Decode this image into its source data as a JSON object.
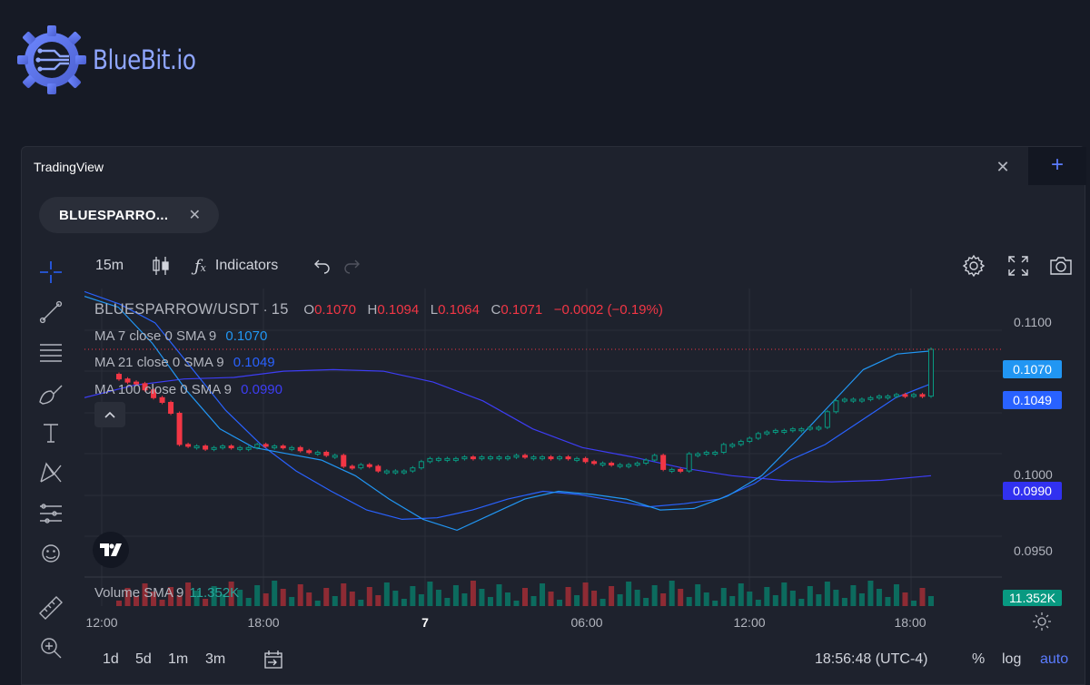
{
  "brand": {
    "name": "BlueBit.io"
  },
  "panel": {
    "title": "TradingView",
    "close": "✕",
    "add": "+"
  },
  "tab": {
    "label": "BLUESPARRO...",
    "close": "✕"
  },
  "left_toolbar": [
    "crosshair-icon",
    "trend-line-icon",
    "fib-retracement-icon",
    "brush-icon",
    "text-icon",
    "pattern-icon",
    "prediction-icon",
    "emoji-icon",
    "ruler-icon",
    "zoom-in-icon"
  ],
  "top_toolbar": {
    "interval": "15m",
    "chart_type_icon": "candles-icon",
    "indicators": "Indicators",
    "undo_icon": "undo-icon",
    "redo_icon": "redo-icon",
    "settings_icon": "gear-icon",
    "fullscreen_icon": "fullscreen-icon",
    "snapshot_icon": "camera-icon"
  },
  "legend": {
    "symbol": "BLUESPARROW/USDT",
    "interval": "15",
    "o_key": "O",
    "o": "0.1070",
    "h_key": "H",
    "h": "0.1094",
    "l_key": "L",
    "l": "0.1064",
    "c_key": "C",
    "c": "0.1071",
    "change": "−0.0002 (−0.19%)",
    "ma7": {
      "label": "MA 7 close 0 SMA 9",
      "value": "0.1070",
      "color": "#2196f3"
    },
    "ma21": {
      "label": "MA 21 close 0 SMA 9",
      "value": "0.1049",
      "color": "#2962ff"
    },
    "ma100": {
      "label": "MA 100 close 0 SMA 9",
      "value": "0.0990",
      "color": "#3d3df5"
    },
    "volume": {
      "label": "Volume SMA 9",
      "value": "11.352K"
    }
  },
  "price_axis": {
    "ticks": [
      "0.1100",
      "0.1000",
      "0.0950"
    ],
    "labels": [
      {
        "text": "0.1070",
        "color": "#2196f3"
      },
      {
        "text": "0.1049",
        "color": "#2962ff"
      },
      {
        "text": "0.0990",
        "color": "#3131f0"
      },
      {
        "text": "11.352K",
        "color": "#089981"
      }
    ]
  },
  "time_axis": [
    "12:00",
    "18:00",
    "7",
    "06:00",
    "12:00",
    "18:00"
  ],
  "bottom_bar": {
    "ranges": [
      "1d",
      "5d",
      "1m",
      "3m"
    ],
    "goto_icon": "goto-date-icon",
    "clock": "18:56:48 (UTC-4)",
    "percent": "%",
    "log": "log",
    "auto": "auto",
    "auto_color": "#5b7cff",
    "settings_icon": "sun-gear-icon"
  },
  "chart_data": {
    "type": "candlestick",
    "symbol": "BLUESPARROW/USDT",
    "interval": "15",
    "ylim": [
      0.0925,
      0.111
    ],
    "gridlines": true,
    "x_ticks": [
      "12:00",
      "18:00",
      "7",
      "06:00",
      "12:00",
      "18:00"
    ],
    "candles_close": [
      0.1052,
      0.105,
      0.1049,
      0.1045,
      0.104,
      0.1037,
      0.103,
      0.101,
      0.1009,
      0.1009,
      0.1007,
      0.1008,
      0.1009,
      0.1008,
      0.1008,
      0.1008,
      0.101,
      0.1009,
      0.1009,
      0.1008,
      0.1008,
      0.1006,
      0.1005,
      0.1005,
      0.1003,
      0.1003,
      0.0996,
      0.0995,
      0.0997,
      0.0996,
      0.0993,
      0.0993,
      0.0993,
      0.0993,
      0.0995,
      0.0999,
      0.1001,
      0.1001,
      0.1001,
      0.1001,
      0.1002,
      0.1001,
      0.1002,
      0.1002,
      0.1002,
      0.1002,
      0.1003,
      0.1002,
      0.1002,
      0.1002,
      0.1001,
      0.1002,
      0.1001,
      0.1001,
      0.0999,
      0.0998,
      0.0998,
      0.0997,
      0.0997,
      0.0997,
      0.0998,
      0.1,
      0.1003,
      0.0994,
      0.0994,
      0.0993,
      0.1004,
      0.1004,
      0.1005,
      0.1005,
      0.101,
      0.101,
      0.1012,
      0.1014,
      0.1017,
      0.1018,
      0.1019,
      0.1019,
      0.102,
      0.102,
      0.1021,
      0.1021,
      0.1031,
      0.1038,
      0.1039,
      0.1039,
      0.1039,
      0.104,
      0.1041,
      0.1041,
      0.1042,
      0.1041,
      0.1042,
      0.1041,
      0.1071
    ],
    "ma7": [
      0.1105,
      0.1098,
      0.1075,
      0.1045,
      0.102,
      0.1008,
      0.1004,
      0.1,
      0.099,
      0.0975,
      0.0962,
      0.0955,
      0.0965,
      0.0975,
      0.098,
      0.0978,
      0.0975,
      0.0968,
      0.0969,
      0.0977,
      0.099,
      0.1012,
      0.1035,
      0.1058,
      0.1068,
      0.107
    ],
    "ma21": [
      0.1108,
      0.11,
      0.1088,
      0.106,
      0.1032,
      0.101,
      0.0993,
      0.098,
      0.0968,
      0.0962,
      0.0963,
      0.0968,
      0.0975,
      0.098,
      0.0978,
      0.0974,
      0.097,
      0.0972,
      0.0975,
      0.0985,
      0.1,
      0.101,
      0.1025,
      0.104,
      0.1049
    ],
    "ma100": [
      0.104,
      0.1048,
      0.1052,
      0.1053,
      0.1057,
      0.1058,
      0.1057,
      0.105,
      0.1038,
      0.102,
      0.1008,
      0.1002,
      0.0995,
      0.099,
      0.0987,
      0.0986,
      0.0987,
      0.099
    ]
  }
}
